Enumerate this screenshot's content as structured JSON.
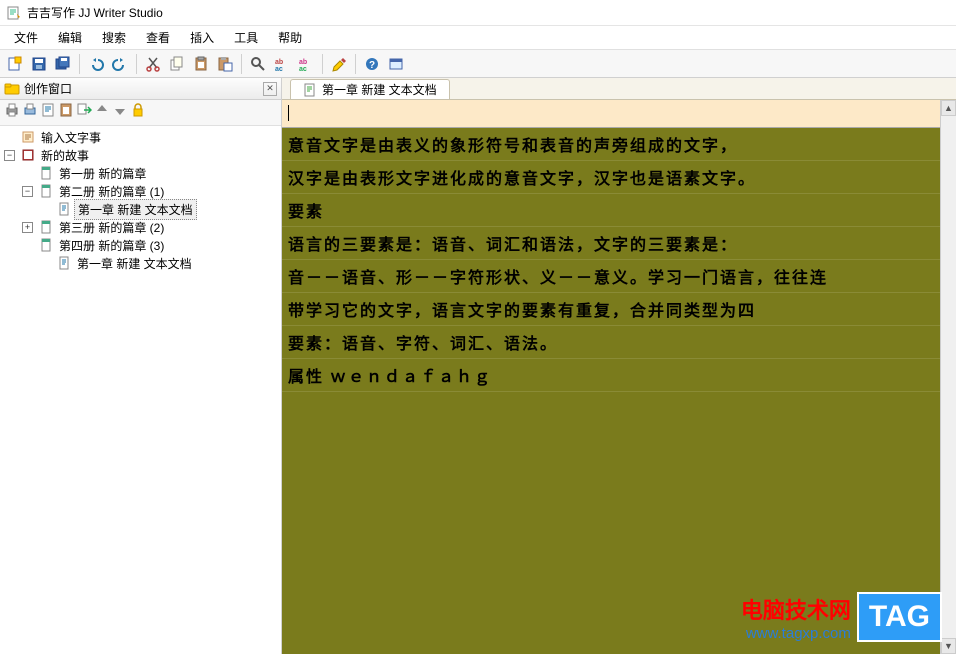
{
  "titlebar": {
    "title": "吉吉写作 JJ Writer Studio"
  },
  "menubar": {
    "items": [
      "文件",
      "编辑",
      "搜索",
      "查看",
      "插入",
      "工具",
      "帮助"
    ]
  },
  "toolbar": {
    "groups": [
      [
        "new-icon",
        "save-icon",
        "save-all-icon"
      ],
      [
        "undo-icon",
        "redo-icon"
      ],
      [
        "cut-icon",
        "copy-icon",
        "paste-icon",
        "paste-special-icon"
      ],
      [
        "find-icon",
        "find-replace-icon",
        "replace-colored-icon"
      ],
      [
        "highlight-icon"
      ],
      [
        "help-icon",
        "window-icon"
      ]
    ]
  },
  "leftpane": {
    "title": "创作窗口",
    "toolbar": [
      "print-icon",
      "print2-icon",
      "text-icon",
      "paste-icon",
      "export-icon",
      "up-icon",
      "down-icon",
      "lock-icon"
    ],
    "tree": [
      {
        "level": 0,
        "exp": null,
        "icon": "scroll",
        "label": "输入文字事"
      },
      {
        "level": 0,
        "exp": "-",
        "icon": "book",
        "label": "新的故事"
      },
      {
        "level": 1,
        "exp": null,
        "icon": "page",
        "label": "第一册 新的篇章"
      },
      {
        "level": 1,
        "exp": "-",
        "icon": "page",
        "label": "第二册 新的篇章 (1)"
      },
      {
        "level": 2,
        "exp": null,
        "icon": "text",
        "label": "第一章 新建 文本文档",
        "selected": true
      },
      {
        "level": 1,
        "exp": "+",
        "icon": "page",
        "label": "第三册 新的篇章 (2)"
      },
      {
        "level": 1,
        "exp": null,
        "icon": "page",
        "label": "第四册 新的篇章 (3)"
      },
      {
        "level": 2,
        "exp": null,
        "icon": "text",
        "label": "第一章 新建 文本文档"
      }
    ]
  },
  "rightpane": {
    "tab_label": "第一章 新建 文本文档",
    "lines": [
      "意音文字是由表义的象形符号和表音的声旁组成的文字，",
      "汉字是由表形文字进化成的意音文字，汉字也是语素文字。",
      "要素",
      "语言的三要素是：语音、词汇和语法，文字的三要素是：",
      "音－－语音、形－－字符形状、义－－意义。学习一门语言，往往连",
      "带学习它的文字，语言文字的要素有重复，合并同类型为四",
      "要素：语音、字符、词汇、语法。",
      "属性  ｗｅｎｄａｆａｈｇ"
    ]
  },
  "watermark": {
    "line1": "电脑技术网",
    "line2": "www.tagxp.com",
    "tag": "TAG"
  }
}
